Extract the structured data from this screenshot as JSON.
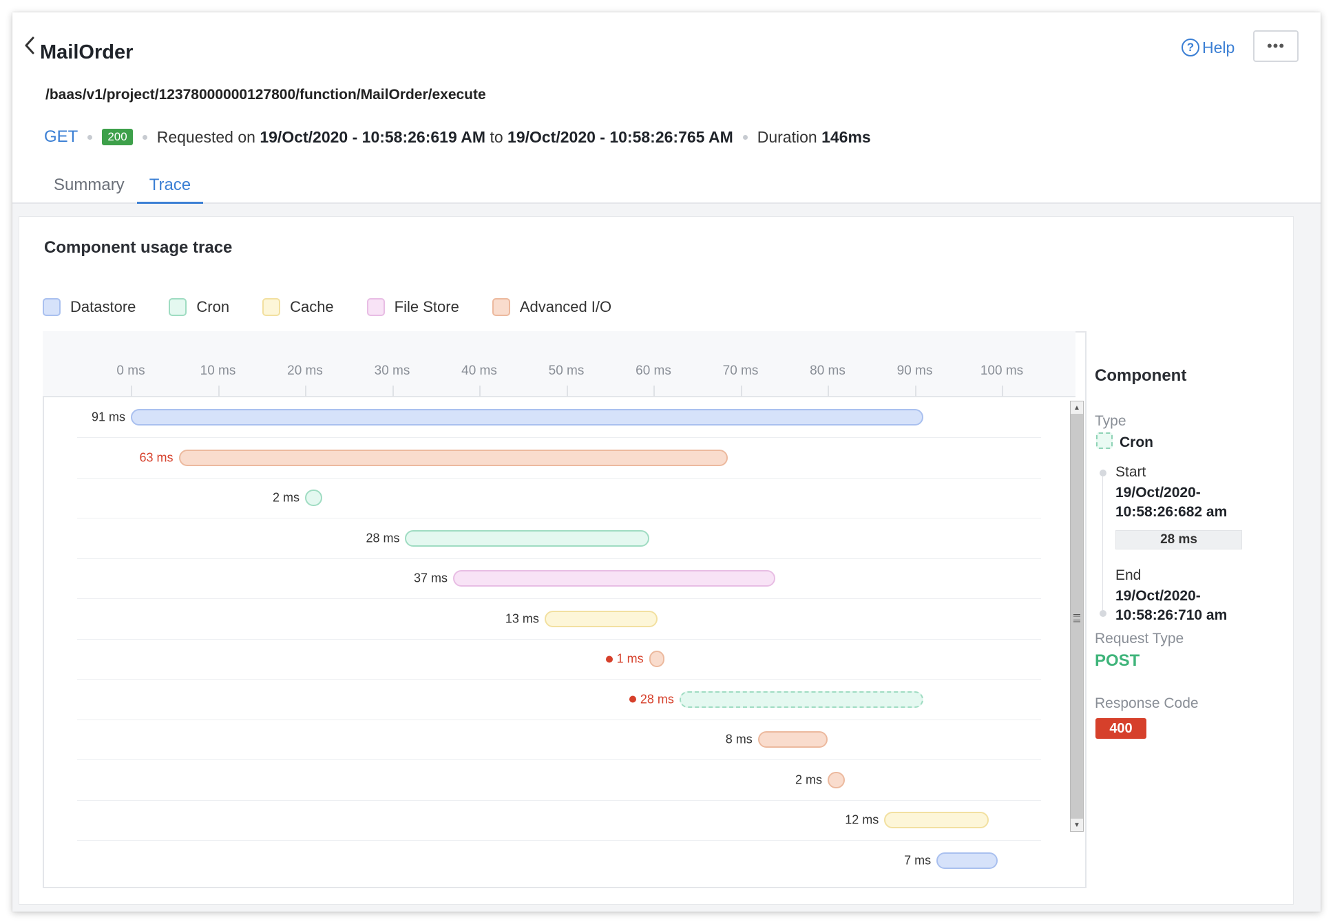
{
  "header": {
    "title": "MailOrder",
    "help_label": "Help",
    "more_label": "•••",
    "url": "/baas/v1/project/12378000000127800/function/MailOrder/execute",
    "method": "GET",
    "status_code": "200",
    "requested_on_label": "Requested on",
    "start_time": "19/Oct/2020 - 10:58:26:619 AM",
    "to_label": "to",
    "end_time": "19/Oct/2020 - 10:58:26:765 AM",
    "duration_label": "Duration",
    "duration_value": "146ms"
  },
  "tabs": [
    {
      "label": "Summary",
      "active": false
    },
    {
      "label": "Trace",
      "active": true
    }
  ],
  "trace": {
    "title": "Component usage trace",
    "legend": [
      {
        "key": "datastore",
        "label": "Datastore",
        "fill": "#d6e2fa",
        "stroke": "#a9c0ef"
      },
      {
        "key": "cron",
        "label": "Cron",
        "fill": "#e4f8f0",
        "stroke": "#9fdcc2"
      },
      {
        "key": "cache",
        "label": "Cache",
        "fill": "#fdf6d8",
        "stroke": "#f2e0a0"
      },
      {
        "key": "filestore",
        "label": "File Store",
        "fill": "#f8e3f6",
        "stroke": "#e8bde4"
      },
      {
        "key": "advancedio",
        "label": "Advanced I/O",
        "fill": "#f9dccd",
        "stroke": "#ecb99e"
      }
    ],
    "axis": {
      "unit": "ms",
      "min": 0,
      "max": 100,
      "ticks": [
        0,
        10,
        20,
        30,
        40,
        50,
        60,
        70,
        80,
        90,
        100
      ],
      "tick_labels": [
        "0 ms",
        "10 ms",
        "20 ms",
        "30 ms",
        "40 ms",
        "50 ms",
        "60 ms",
        "70 ms",
        "80 ms",
        "90 ms",
        "100 ms"
      ]
    },
    "rows": [
      {
        "start": 0,
        "duration": 91,
        "label": "91 ms",
        "type": "datastore",
        "error": false,
        "dashed": false
      },
      {
        "start": 5.5,
        "duration": 63,
        "label": "63 ms",
        "type": "advancedio",
        "error": true,
        "dashed": false,
        "dot": false
      },
      {
        "start": 20,
        "duration": 2,
        "label": "2 ms",
        "type": "cron",
        "error": false,
        "dashed": false
      },
      {
        "start": 31.5,
        "duration": 28,
        "label": "28 ms",
        "type": "cron",
        "error": false,
        "dashed": false
      },
      {
        "start": 37,
        "duration": 37,
        "label": "37 ms",
        "type": "filestore",
        "error": false,
        "dashed": false
      },
      {
        "start": 47.5,
        "duration": 13,
        "label": "13 ms",
        "type": "cache",
        "error": false,
        "dashed": false
      },
      {
        "start": 59.5,
        "duration": 1,
        "label": "1 ms",
        "type": "advancedio",
        "error": true,
        "dashed": false,
        "dot": true
      },
      {
        "start": 63,
        "duration": 28,
        "label": "28 ms",
        "type": "cron",
        "error": true,
        "dashed": true,
        "dot": true
      },
      {
        "start": 72,
        "duration": 8,
        "label": "8 ms",
        "type": "advancedio",
        "error": false,
        "dashed": false
      },
      {
        "start": 80,
        "duration": 2,
        "label": "2 ms",
        "type": "advancedio",
        "error": false,
        "dashed": false
      },
      {
        "start": 86.5,
        "duration": 12,
        "label": "12 ms",
        "type": "cache",
        "error": false,
        "dashed": false
      },
      {
        "start": 92.5,
        "duration": 7,
        "label": "7 ms",
        "type": "datastore",
        "error": false,
        "dashed": false
      }
    ]
  },
  "component": {
    "title": "Component",
    "type_label": "Type",
    "type_value": "Cron",
    "start_label": "Start",
    "start_value": "19/Oct/2020-\n10:58:26:682 am",
    "duration_value": "28 ms",
    "end_label": "End",
    "end_value": "19/Oct/2020-\n10:58:26:710 am",
    "request_type_label": "Request Type",
    "request_type_value": "POST",
    "response_code_label": "Response Code",
    "response_code_value": "400"
  }
}
